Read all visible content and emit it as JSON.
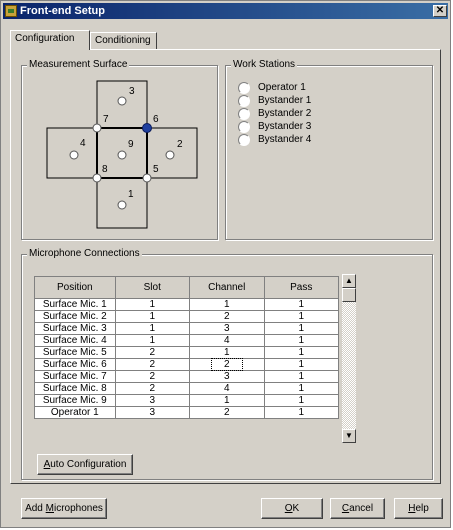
{
  "window": {
    "title": "Front-end Setup",
    "close_glyph": "✕"
  },
  "tabs": [
    {
      "label": "Configuration",
      "active": true
    },
    {
      "label": "Conditioning",
      "active": false
    }
  ],
  "measurement_surface": {
    "legend": "Measurement Surface",
    "positions": [
      "1",
      "2",
      "3",
      "4",
      "5",
      "6",
      "7",
      "8",
      "9"
    ],
    "selected_position": "6"
  },
  "work_stations": {
    "legend": "Work Stations",
    "items": [
      "Operator 1",
      "Bystander 1",
      "Bystander 2",
      "Bystander 3",
      "Bystander 4"
    ]
  },
  "mic_connections": {
    "legend": "Microphone Connections",
    "columns": [
      "Position",
      "Slot",
      "Channel",
      "Pass"
    ],
    "rows": [
      [
        "Surface Mic. 1",
        "1",
        "1",
        "1"
      ],
      [
        "Surface Mic. 2",
        "1",
        "2",
        "1"
      ],
      [
        "Surface Mic. 3",
        "1",
        "3",
        "1"
      ],
      [
        "Surface Mic. 4",
        "1",
        "4",
        "1"
      ],
      [
        "Surface Mic. 5",
        "2",
        "1",
        "1"
      ],
      [
        "Surface Mic. 6",
        "2",
        "2",
        "1"
      ],
      [
        "Surface Mic. 7",
        "2",
        "3",
        "1"
      ],
      [
        "Surface Mic. 8",
        "2",
        "4",
        "1"
      ],
      [
        "Surface Mic. 9",
        "3",
        "1",
        "1"
      ],
      [
        "Operator 1",
        "3",
        "2",
        "1"
      ]
    ],
    "focused_cell": {
      "row": 5,
      "col": 2
    },
    "auto_config_label_prefix": "A",
    "auto_config_label_rest": "uto Configuration"
  },
  "buttons": {
    "add_mics_prefix": "Add ",
    "add_mics_ul": "M",
    "add_mics_rest": "icrophones",
    "ok_ul": "O",
    "ok_rest": "K",
    "cancel_ul": "C",
    "cancel_rest": "ancel",
    "help_ul": "H",
    "help_rest": "elp"
  },
  "icons": {
    "scroll_up": "▲",
    "scroll_down": "▼"
  },
  "colors": {
    "selected_marker": "#1f3f9f",
    "titlebar": "#0a246a"
  }
}
